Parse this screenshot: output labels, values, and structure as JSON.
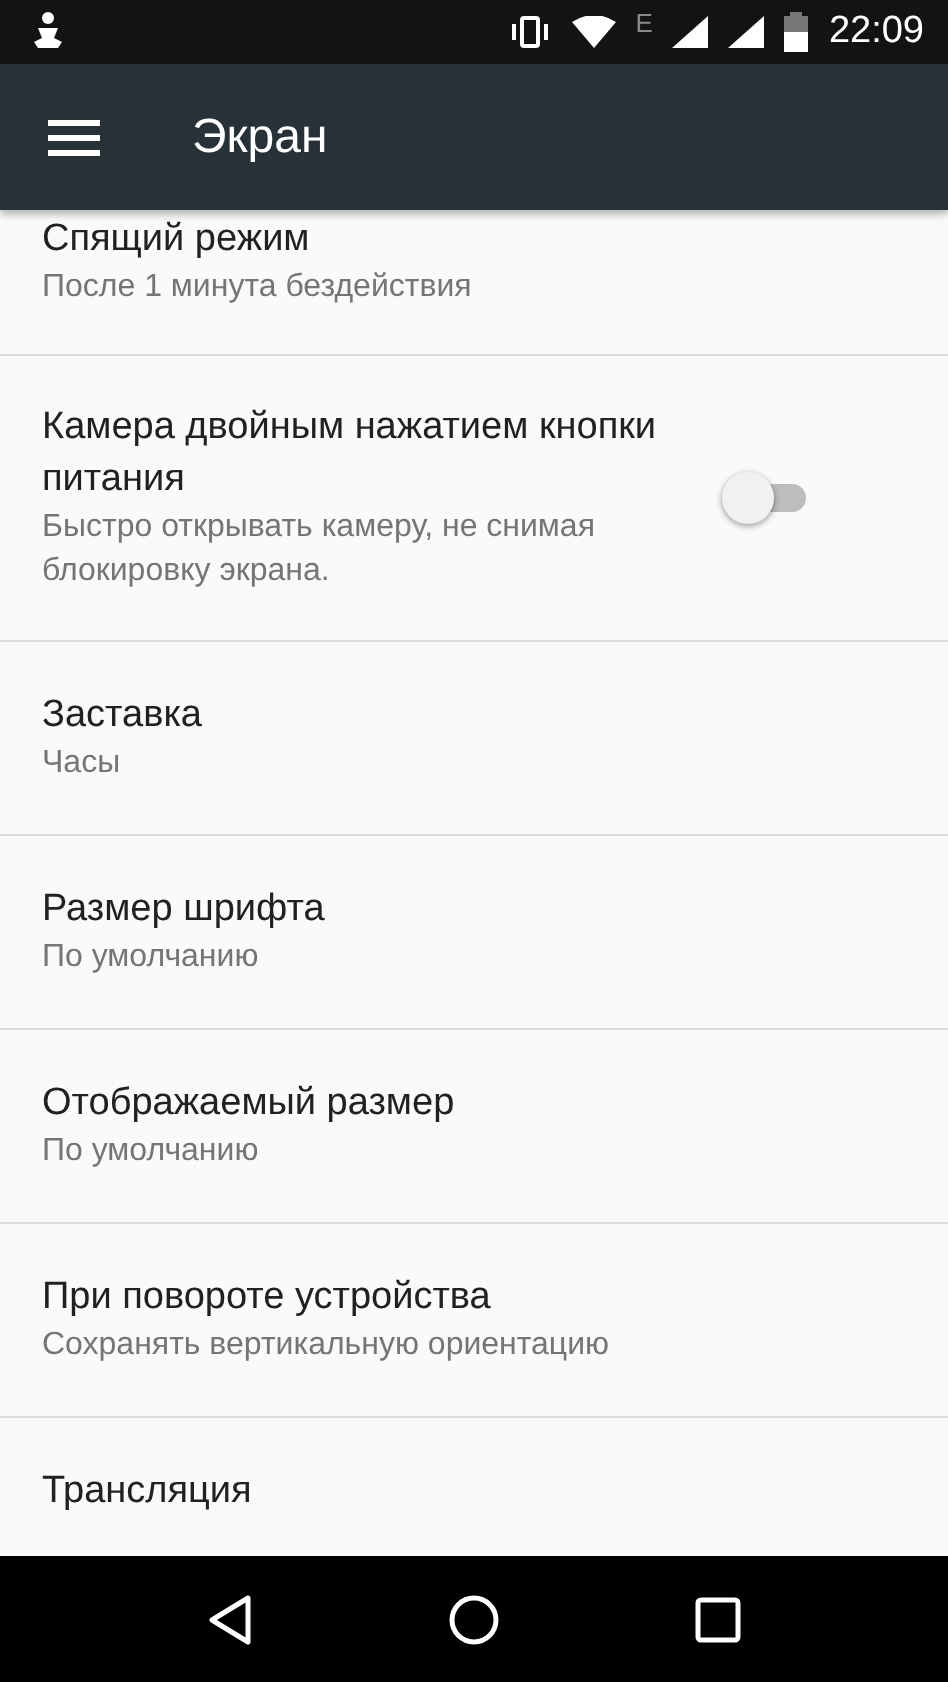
{
  "status_bar": {
    "network_label": "E",
    "time": "22:09"
  },
  "app_bar": {
    "title": "Экран"
  },
  "settings": [
    {
      "kind": "text",
      "title": "Спящий режим",
      "summary": "После 1 минута бездействия"
    },
    {
      "kind": "switch",
      "title": "Камера двойным нажатием кнопки питания",
      "summary": "Быстро открывать камеру, не снимая блокировку экрана.",
      "on": false
    },
    {
      "kind": "text",
      "title": "Заставка",
      "summary": "Часы"
    },
    {
      "kind": "text",
      "title": "Размер шрифта",
      "summary": "По умолчанию"
    },
    {
      "kind": "text",
      "title": "Отображаемый размер",
      "summary": "По умолчанию"
    },
    {
      "kind": "text",
      "title": "При повороте устройства",
      "summary": "Сохранять вертикальную ориентацию"
    },
    {
      "kind": "text",
      "title": "Трансляция"
    }
  ]
}
